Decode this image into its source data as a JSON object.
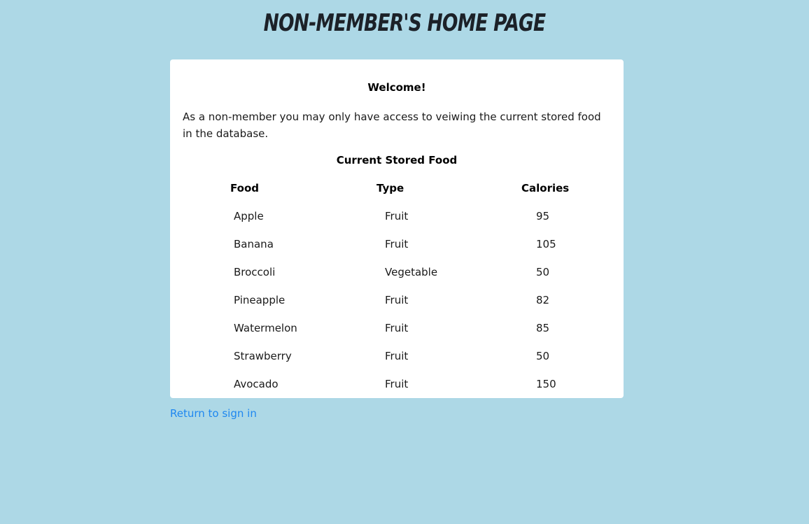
{
  "header": {
    "title": "Non-Member's Home Page"
  },
  "card": {
    "welcome": "Welcome!",
    "intro": "As a non-member you may only have access to veiwing the current stored food in the database.",
    "table_title": "Current Stored Food",
    "columns": [
      "Food",
      "Type",
      "Calories"
    ],
    "rows": [
      {
        "food": "Apple",
        "type": "Fruit",
        "calories": "95"
      },
      {
        "food": "Banana",
        "type": "Fruit",
        "calories": "105"
      },
      {
        "food": "Broccoli",
        "type": "Vegetable",
        "calories": "50"
      },
      {
        "food": "Pineapple",
        "type": "Fruit",
        "calories": "82"
      },
      {
        "food": "Watermelon",
        "type": "Fruit",
        "calories": "85"
      },
      {
        "food": "Strawberry",
        "type": "Fruit",
        "calories": "50"
      },
      {
        "food": "Avocado",
        "type": "Fruit",
        "calories": "150"
      }
    ]
  },
  "footer": {
    "return_link": "Return to sign in"
  },
  "colors": {
    "background": "#add8e6",
    "card": "#ffffff",
    "link": "#1e87f0"
  }
}
